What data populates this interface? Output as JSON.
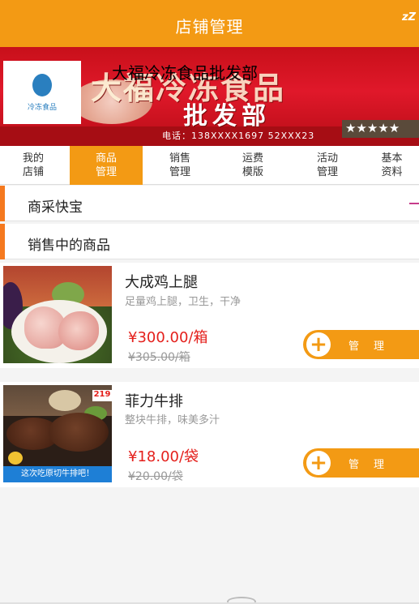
{
  "header": {
    "title": "店铺管理",
    "status_icon_glyph": "zZ"
  },
  "banner": {
    "shop_name": "大福冷冻食品批发部",
    "big_text": "大福冷冻食品",
    "sub_text": "批发部",
    "phone": "电话：138XXXX1697   52XXX23",
    "logo_text": "冷冻食品",
    "stars": "★★★★★"
  },
  "tabs": [
    {
      "l1": "我的",
      "l2": "店铺"
    },
    {
      "l1": "商品",
      "l2": "管理"
    },
    {
      "l1": "销售",
      "l2": "管理"
    },
    {
      "l1": "运费",
      "l2": "模版"
    },
    {
      "l1": "活动",
      "l2": "管理"
    },
    {
      "l1": "基本",
      "l2": "资料"
    }
  ],
  "sections": {
    "shop_treasure": "商采快宝",
    "on_sale": "销售中的商品"
  },
  "products": [
    {
      "name": "大成鸡上腿",
      "desc": "足量鸡上腿，卫生，干净",
      "price": "¥300.00/箱",
      "old_price": "¥305.00/箱",
      "manage": "管理"
    },
    {
      "name": "菲力牛排",
      "desc": "整块牛排，味美多汁",
      "price": "¥18.00/袋",
      "old_price": "¥20.00/袋",
      "manage": "管理",
      "image_badge": "219",
      "image_banner": "这次吃原切牛排吧！"
    }
  ],
  "colors": {
    "accent": "#f39a14",
    "price": "#e4201c"
  }
}
